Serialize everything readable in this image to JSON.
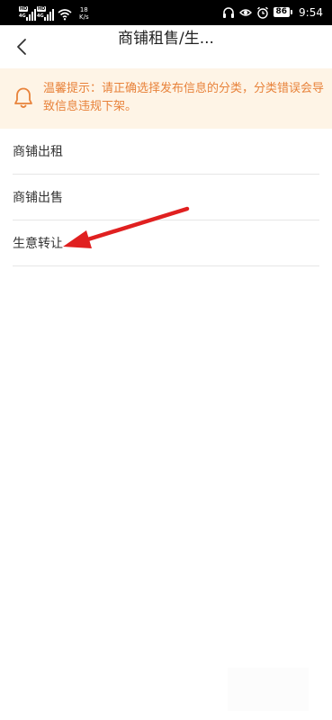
{
  "status_bar": {
    "net_speed_value": "18",
    "net_speed_unit": "K/s",
    "battery": "86",
    "time": "9:54",
    "sim1_tag": "HD",
    "sim1_net": "4G",
    "sim2_tag": "HD",
    "sim2_net": "4G"
  },
  "header": {
    "back_icon": "chevron-left-icon",
    "title": "商铺租售/生..."
  },
  "notice": {
    "icon": "bell-icon",
    "text": "温馨提示：请正确选择发布信息的分类，分类错误会导致信息违规下架。"
  },
  "categories": [
    {
      "label": "商铺出租"
    },
    {
      "label": "商铺出售"
    },
    {
      "label": "生意转让"
    }
  ],
  "colors": {
    "notice_bg": "#fef4e6",
    "notice_text": "#e8823a",
    "annotation_arrow": "#e02020"
  }
}
